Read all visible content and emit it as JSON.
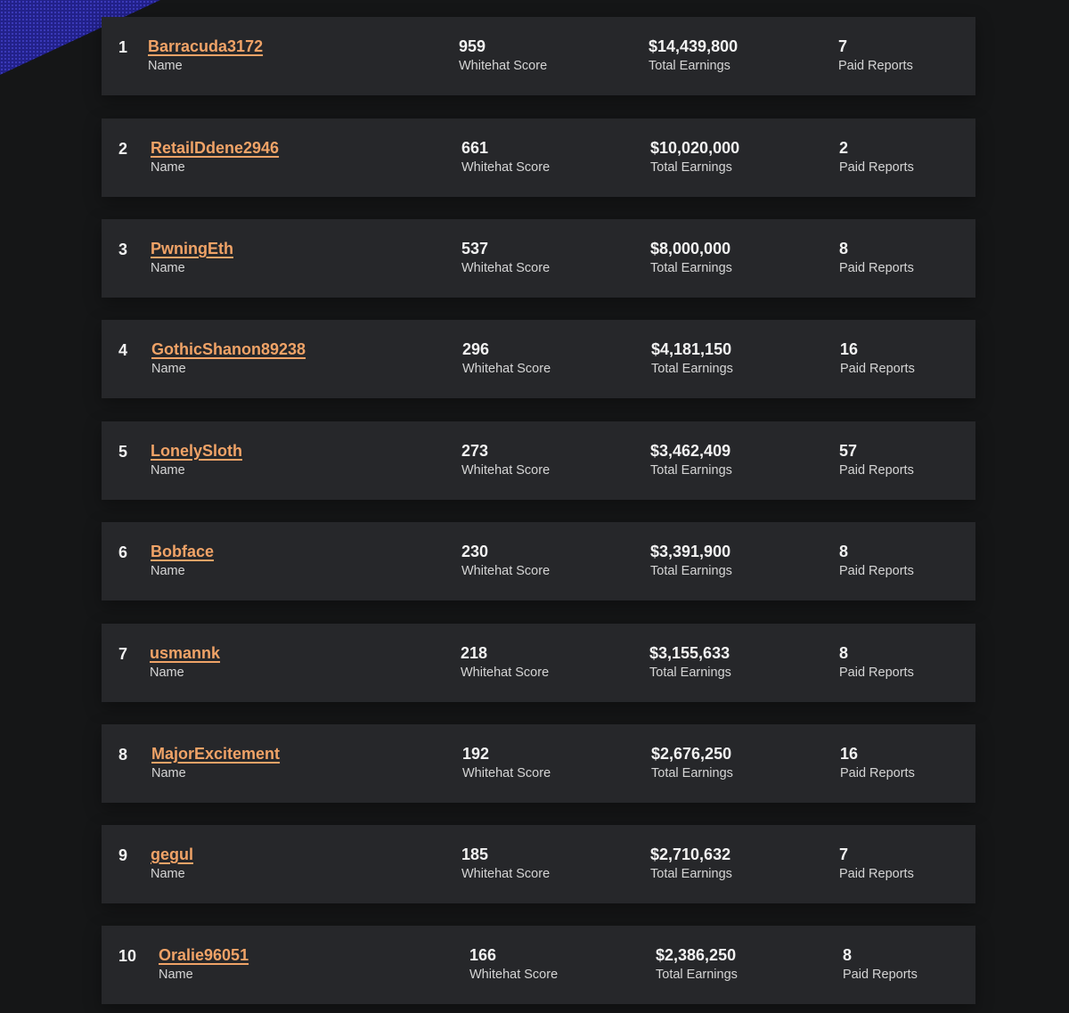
{
  "labels": {
    "name": "Name",
    "score": "Whitehat Score",
    "earnings": "Total Earnings",
    "reports": "Paid Reports"
  },
  "rows": [
    {
      "rank": "1",
      "name": "Barracuda3172",
      "score": "959",
      "earnings": "$14,439,800",
      "reports": "7"
    },
    {
      "rank": "2",
      "name": "RetailDdene2946",
      "score": "661",
      "earnings": "$10,020,000",
      "reports": "2"
    },
    {
      "rank": "3",
      "name": "PwningEth",
      "score": "537",
      "earnings": "$8,000,000",
      "reports": "8"
    },
    {
      "rank": "4",
      "name": "GothicShanon89238",
      "score": "296",
      "earnings": "$4,181,150",
      "reports": "16"
    },
    {
      "rank": "5",
      "name": "LonelySloth",
      "score": "273",
      "earnings": "$3,462,409",
      "reports": "57"
    },
    {
      "rank": "6",
      "name": "Bobface",
      "score": "230",
      "earnings": "$3,391,900",
      "reports": "8"
    },
    {
      "rank": "7",
      "name": "usmannk",
      "score": "218",
      "earnings": "$3,155,633",
      "reports": "8"
    },
    {
      "rank": "8",
      "name": "MajorExcitement",
      "score": "192",
      "earnings": "$2,676,250",
      "reports": "16"
    },
    {
      "rank": "9",
      "name": "gegul",
      "score": "185",
      "earnings": "$2,710,632",
      "reports": "7"
    },
    {
      "rank": "10",
      "name": "Oralie96051",
      "score": "166",
      "earnings": "$2,386,250",
      "reports": "8"
    }
  ]
}
